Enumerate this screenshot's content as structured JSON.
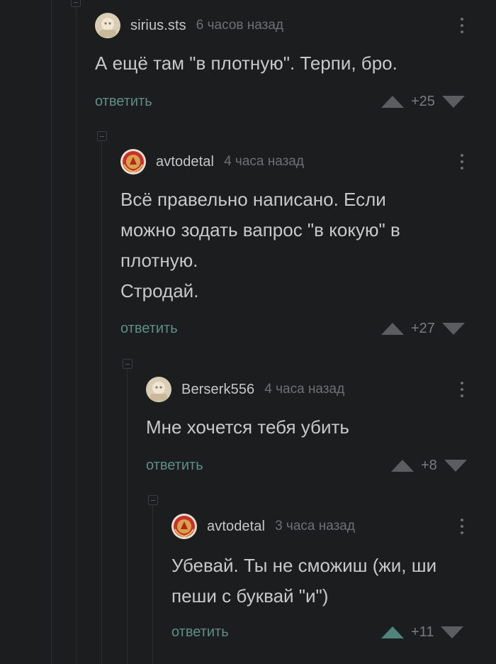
{
  "comments": [
    {
      "username": "sirius.sts",
      "time": "6 часов назад",
      "text": "А ещё там \"в плотную\". Терпи, бро.",
      "reply": "ответить",
      "score": "+25"
    },
    {
      "username": "avtodetal",
      "time": "4 часа назад",
      "text": "Всё правельно написано. Если\nможно зодать вапрос \"в кокую\" в\nплотную.\nСтродай.",
      "reply": "ответить",
      "score": "+27"
    },
    {
      "username": "Berserk556",
      "time": "4 часа назад",
      "text": "Мне хочется тебя убить",
      "reply": "ответить",
      "score": "+8"
    },
    {
      "username": "avtodetal",
      "time": "3 часа назад",
      "text": "Убевай. Ты не сможиш (жи, ши\nпеши с буквай \"и\")",
      "reply": "ответить",
      "score": "+11"
    }
  ],
  "colors": {
    "background": "#1c1d1f",
    "accent_green": "#5f8e84",
    "upvote_active": "#4f857a",
    "muted": "#6f7073"
  }
}
